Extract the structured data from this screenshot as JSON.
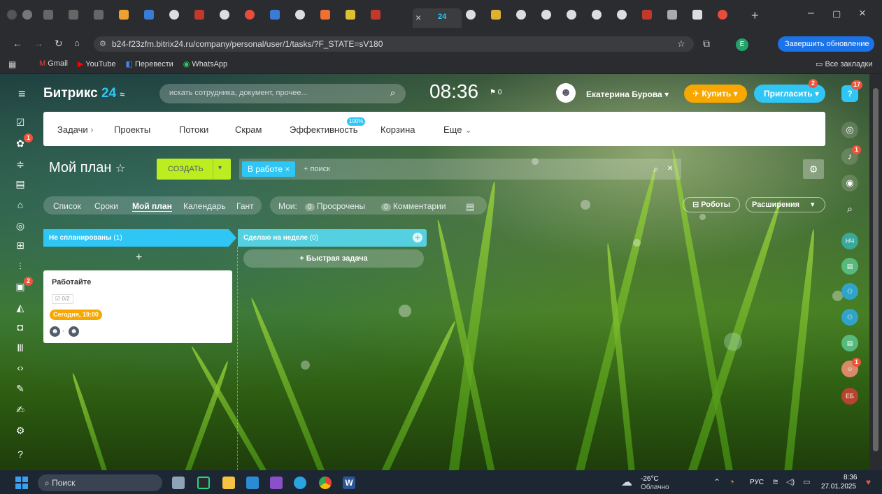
{
  "browser": {
    "url": "b24-f23zfm.bitrix24.ru/company/personal/user/1/tasks/?F_STATE=sV180",
    "update_button": "Завершить обновление",
    "profile_letter": "E",
    "bookmarks": [
      {
        "label": "Gmail"
      },
      {
        "label": "YouTube"
      },
      {
        "label": "Перевести"
      },
      {
        "label": "WhatsApp"
      }
    ],
    "all_bookmarks": "Все закладки",
    "active_tab_label": "24"
  },
  "header": {
    "logo_text": "Битрикс",
    "logo_num": "24",
    "search_placeholder": "искать сотрудника, документ, прочее...",
    "time": "08:36",
    "flag_count": "0",
    "user_name": "Екатерина Бурова",
    "buy_label": "Купить",
    "invite_label": "Пригласить",
    "invite_badge": "2",
    "help_badge": "17"
  },
  "menu": {
    "items": [
      "Задачи",
      "Проекты",
      "Потоки",
      "Скрам",
      "Эффективность",
      "Корзина",
      "Еще"
    ],
    "efficiency_badge": "100%"
  },
  "plan": {
    "title": "Мой план",
    "create_label": "СОЗДАТЬ",
    "filter_chip": "В работе",
    "filter_placeholder": "+ поиск"
  },
  "views": {
    "items": [
      "Список",
      "Сроки",
      "Мой план",
      "Календарь",
      "Гант"
    ],
    "mine": "Мои:",
    "overdue_count": "0",
    "overdue": "Просрочены",
    "comments_count": "0",
    "comments": "Комментарии",
    "robots": "Роботы",
    "extensions": "Расширения"
  },
  "kanban": {
    "col1": "Не спланированы",
    "col1_count": "(1)",
    "col2": "Сделаю на неделе",
    "col2_count": "(0)",
    "quick_task": "+ Быстрая задача",
    "card_title": "Работайте",
    "card_checklist": "0/2",
    "card_deadline": "Сегодня, 19:00"
  },
  "right_sidebar": {
    "avatar1": "НЧ",
    "avatar2": "ЕБ",
    "bell_badge": "1",
    "avatar_badge": "1"
  },
  "left_sidebar": {
    "badge1": "1",
    "badge2": "2"
  },
  "taskbar": {
    "search": "Поиск",
    "weather_temp": "-26°C",
    "weather_text": "Облачно",
    "lang": "РУС",
    "time": "8:36",
    "date": "27.01.2025"
  },
  "colors": {
    "accent": "#2fc6f6",
    "create": "#bbed21",
    "buy": "#f7a700",
    "deadline": "#f7a700"
  }
}
